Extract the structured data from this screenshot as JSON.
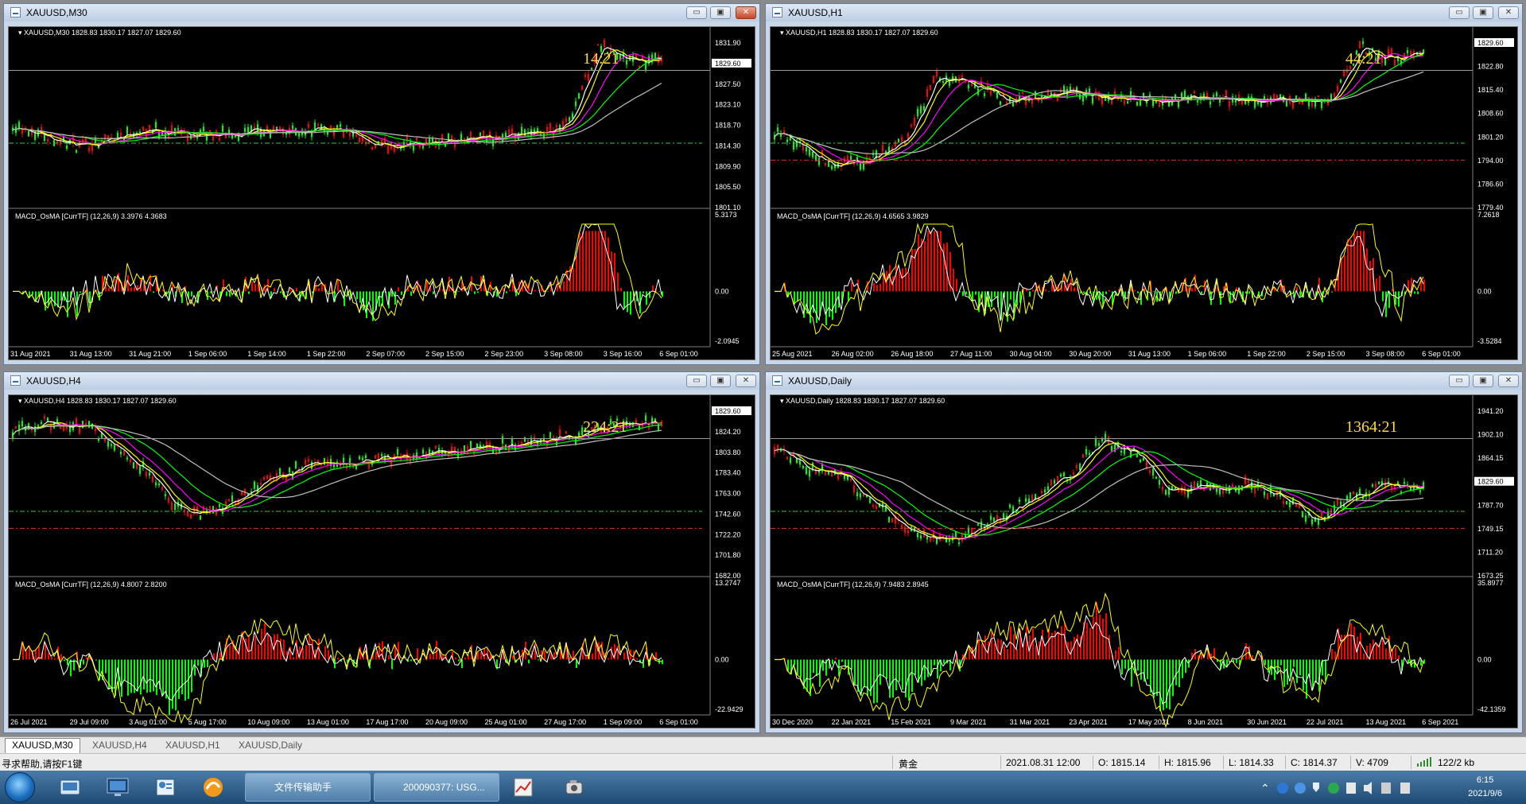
{
  "windows": [
    {
      "id": "m30",
      "title": "XAUUSD,M30",
      "info": "XAUUSD,M30  1828.83 1830.17 1827.07 1829.60",
      "countdown": "14:21",
      "price_ticks": [
        "1831.90",
        "1829.60",
        "1827.50",
        "1823.10",
        "1818.70",
        "1814.30",
        "1809.90",
        "1805.50",
        "1801.10"
      ],
      "indicator": "MACD_OsMA [CurrTF] (12,26,9) 3.3976 4.3683",
      "ind_ticks": [
        "5.3173",
        "0.00",
        "-2.0945"
      ],
      "time_ticks": [
        "31 Aug 2021",
        "31 Aug 13:00",
        "31 Aug 21:00",
        "1 Sep 06:00",
        "1 Sep 14:00",
        "1 Sep 22:00",
        "2 Sep 07:00",
        "2 Sep 15:00",
        "2 Sep 23:00",
        "3 Sep 08:00",
        "3 Sep 16:00",
        "6 Sep 01:00"
      ],
      "controls": {
        "minimize": "▭",
        "restore": "▣",
        "close": "✕"
      }
    },
    {
      "id": "h1",
      "title": "XAUUSD,H1",
      "info": "XAUUSD,H1  1828.83 1830.17 1827.07 1829.60",
      "countdown": "44:21",
      "price_ticks": [
        "1829.60",
        "1822.80",
        "1815.40",
        "1808.60",
        "1801.20",
        "1794.00",
        "1786.60",
        "1779.40"
      ],
      "indicator": "MACD_OsMA [CurrTF] (12,26,9) 4.6565 3.9829",
      "ind_ticks": [
        "7.2618",
        "0.00",
        "-3.5284"
      ],
      "time_ticks": [
        "25 Aug 2021",
        "26 Aug 02:00",
        "26 Aug 18:00",
        "27 Aug 11:00",
        "30 Aug 04:00",
        "30 Aug 20:00",
        "31 Aug 13:00",
        "1 Sep 06:00",
        "1 Sep 22:00",
        "2 Sep 15:00",
        "3 Sep 08:00",
        "6 Sep 01:00"
      ],
      "controls": {
        "minimize": "▭",
        "restore": "▣",
        "close": "✕"
      }
    },
    {
      "id": "h4",
      "title": "XAUUSD,H4",
      "info": "XAUUSD,H4  1828.83 1830.17 1827.07 1829.60",
      "countdown": "224:21",
      "price_ticks": [
        "1829.60",
        "1824.20",
        "1803.80",
        "1783.40",
        "1763.00",
        "1742.60",
        "1722.20",
        "1701.80",
        "1682.00"
      ],
      "indicator": "MACD_OsMA [CurrTF] (12,26,9) 4.8007 2.8200",
      "ind_ticks": [
        "13.2747",
        "0.00",
        "-22.9429"
      ],
      "time_ticks": [
        "26 Jul 2021",
        "29 Jul 09:00",
        "3 Aug 01:00",
        "5 Aug 17:00",
        "10 Aug 09:00",
        "13 Aug 01:00",
        "17 Aug 17:00",
        "20 Aug 09:00",
        "25 Aug 01:00",
        "27 Aug 17:00",
        "1 Sep 09:00",
        "6 Sep 01:00"
      ],
      "controls": {
        "minimize": "▭",
        "restore": "▣",
        "close": "✕"
      }
    },
    {
      "id": "d1",
      "title": "XAUUSD,Daily",
      "info": "XAUUSD,Daily  1828.83 1830.17 1827.07 1829.60",
      "countdown": "1364:21",
      "price_ticks": [
        "1941.20",
        "1902.10",
        "1864.15",
        "1829.60",
        "1787.70",
        "1749.15",
        "1711.20",
        "1673.25"
      ],
      "indicator": "MACD_OsMA [CurrTF] (12,26,9) 7.9483 2.8945",
      "ind_ticks": [
        "35.8977",
        "0.00",
        "-42.1359"
      ],
      "time_ticks": [
        "30 Dec 2020",
        "22 Jan 2021",
        "15 Feb 2021",
        "9 Mar 2021",
        "31 Mar 2021",
        "23 Apr 2021",
        "17 May 2021",
        "8 Jun 2021",
        "30 Jun 2021",
        "22 Jul 2021",
        "13 Aug 2021",
        "6 Sep 2021"
      ],
      "controls": {
        "minimize": "▭",
        "restore": "▣",
        "close": "✕"
      }
    }
  ],
  "tabs": [
    {
      "label": "XAUUSD,M30",
      "active": true
    },
    {
      "label": "XAUUSD,H4",
      "active": false
    },
    {
      "label": "XAUUSD,H1",
      "active": false
    },
    {
      "label": "XAUUSD,Daily",
      "active": false
    }
  ],
  "status": {
    "help": "寻求帮助,请按F1键",
    "symbol": "黄金",
    "datetime": "2021.08.31 12:00",
    "open": "O: 1815.14",
    "high": "H: 1815.96",
    "low": "L: 1814.33",
    "close": "C: 1814.37",
    "volume": "V: 4709",
    "traffic": "122/2 kb"
  },
  "taskbar": {
    "tasks": [
      "文件传输助手",
      "200090377: USG..."
    ],
    "clock_time": "6:15",
    "clock_date": "2021/9/6"
  },
  "colors": {
    "bull_candle": "#00ff00",
    "bear_candle": "#ff0000",
    "ma_white": "#ffffff",
    "ma_yellow": "#ffff00",
    "ma_magenta": "#ff00ff",
    "ma_green": "#00ff00",
    "ma_gray": "#c0c0c0",
    "countdown": "#ffd84a"
  }
}
